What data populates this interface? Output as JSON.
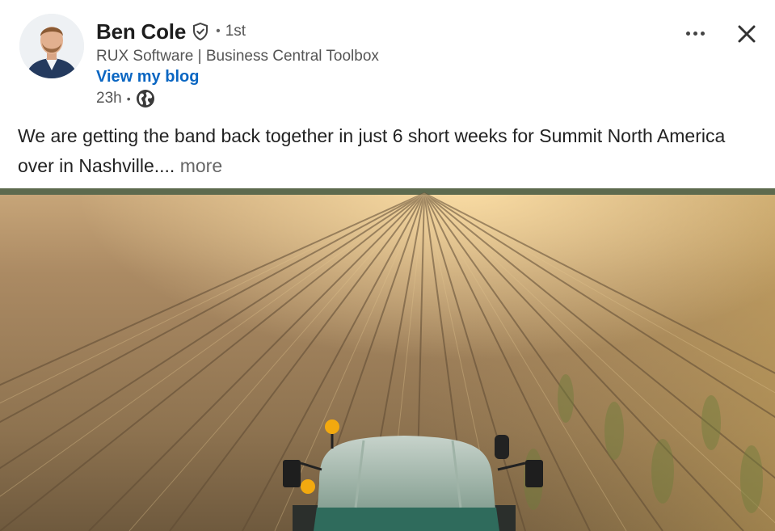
{
  "post": {
    "author": {
      "name": "Ben Cole",
      "connection_degree": "1st",
      "headline": "RUX Software | Business Central Toolbox",
      "link_label": "View my blog",
      "verified": true
    },
    "timestamp": "23h",
    "visibility_icon": "globe-icon",
    "text": "We are getting the band back together in just 6 short weeks for Summit North America over in Nashville....",
    "see_more_label": "more",
    "image": {
      "subject": "tractor-in-cornfield"
    }
  },
  "toolbar": {
    "more_icon": "ellipsis-icon",
    "close_icon": "close-icon"
  },
  "colors": {
    "link": "#0a66c2",
    "text": "#191919",
    "secondary": "#666666"
  }
}
